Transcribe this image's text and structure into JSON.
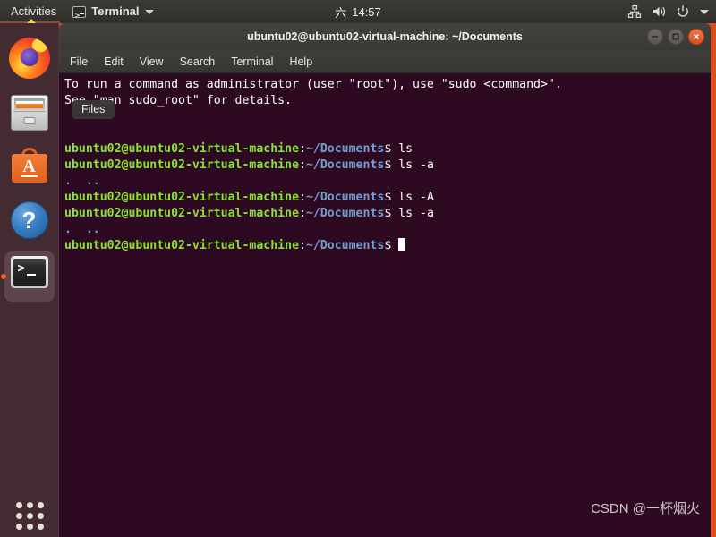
{
  "top_panel": {
    "activities_label": "Activities",
    "app_name": "Terminal",
    "app_icon": "terminal-icon",
    "clock_day": "六",
    "clock_time": "14:57",
    "status_icons": [
      "network-icon",
      "volume-icon",
      "power-icon",
      "chevron-down-icon"
    ]
  },
  "dock": {
    "items": [
      {
        "name": "firefox",
        "label": "Firefox",
        "running": false,
        "active": false
      },
      {
        "name": "files",
        "label": "Files",
        "running": false,
        "active": false
      },
      {
        "name": "ubuntu-software",
        "label": "Ubuntu Software",
        "running": false,
        "active": false
      },
      {
        "name": "help",
        "label": "Help",
        "running": false,
        "active": false
      },
      {
        "name": "terminal",
        "label": "Terminal",
        "running": true,
        "active": true
      }
    ],
    "show_apps_label": "Show Applications"
  },
  "window": {
    "title": "ubuntu02@ubuntu02-virtual-machine: ~/Documents",
    "buttons": {
      "minimize": "minimize-icon",
      "maximize": "maximize-icon",
      "close": "close-icon"
    },
    "menu": [
      "File",
      "Edit",
      "View",
      "Search",
      "Terminal",
      "Help"
    ]
  },
  "terminal": {
    "prompt_user": "ubuntu02@ubuntu02-virtual-machine",
    "prompt_sep": ":",
    "prompt_path": "~/Documents",
    "prompt_tail": "$ ",
    "lines": [
      {
        "type": "text",
        "text": "To run a command as administrator (user \"root\"), use \"sudo <command>\"."
      },
      {
        "type": "text",
        "text": "See \"man sudo_root\" for details."
      },
      {
        "type": "blank"
      },
      {
        "type": "blank"
      },
      {
        "type": "prompt",
        "command": "ls"
      },
      {
        "type": "prompt",
        "command": "ls -a"
      },
      {
        "type": "dirs",
        "text": ".  .."
      },
      {
        "type": "prompt",
        "command": "ls -A"
      },
      {
        "type": "prompt",
        "command": "ls -a"
      },
      {
        "type": "dirs",
        "text": ".  .."
      },
      {
        "type": "prompt",
        "command": "",
        "cursor": true
      }
    ]
  },
  "tooltip": {
    "label": "Files"
  },
  "watermark": {
    "text": "CSDN @一杯烟火"
  },
  "colors": {
    "terminal_bg": "#2d0922",
    "prompt_user": "#8ae234",
    "prompt_path": "#729fcf",
    "desktop_orange": "#d94f20",
    "close_button": "#e04e1a"
  }
}
